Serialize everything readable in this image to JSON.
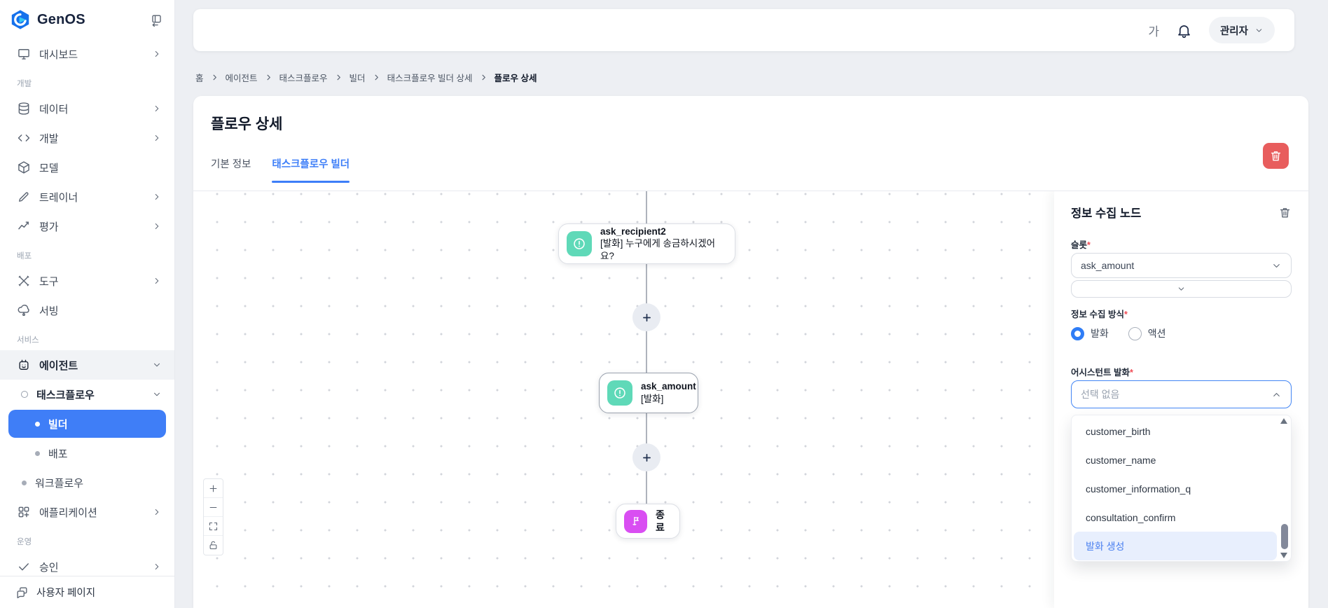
{
  "app": {
    "name": "GenOS"
  },
  "header": {
    "font_toggle": "가",
    "profile": "관리자"
  },
  "sidebar": {
    "logo": "GenOS",
    "sections": {
      "dev": "개발",
      "deploy": "배포",
      "service": "서비스",
      "ops": "운영"
    },
    "items": {
      "dashboard": "대시보드",
      "data": "데이터",
      "develop": "개발",
      "model": "모델",
      "trainer": "트레이너",
      "evaluate": "평가",
      "tools": "도구",
      "serving": "서빙",
      "agent": "에이전트",
      "taskflow": "태스크플로우",
      "builder": "빌더",
      "deploy": "배포",
      "workflow": "워크플로우",
      "application": "애플리케이션",
      "approval": "승인",
      "user_page": "사용자 페이지"
    }
  },
  "breadcrumb": {
    "items": [
      "홈",
      "에이전트",
      "태스크플로우",
      "빌더",
      "태스크플로우 빌더 상세",
      "플로우 상세"
    ]
  },
  "page": {
    "title": "플로우 상세",
    "tabs": {
      "basic": "기본 정보",
      "builder": "태스크플로우 빌더"
    }
  },
  "canvas": {
    "nodes": {
      "recipient": {
        "title": "ask_recipient2",
        "subtitle": "[발화]  누구에게 송금하시겠어요?"
      },
      "amount": {
        "title": "ask_amount",
        "subtitle": "[발화]"
      },
      "end": {
        "label": "종료"
      }
    }
  },
  "panel": {
    "title": "정보 수집 노드",
    "required_mark": "*",
    "slot": {
      "label": "슬롯",
      "value": "ask_amount"
    },
    "method": {
      "label": "정보 수집 방식",
      "selected": "발화",
      "options": {
        "utterance": "발화",
        "action": "액션"
      }
    },
    "assistant": {
      "label": "어시스턴트 발화",
      "value": "선택 없음",
      "options": [
        "customer_birth",
        "customer_name",
        "customer_information_q",
        "consultation_confirm",
        "발화 생성"
      ],
      "highlighted": "발화 생성"
    }
  },
  "colors": {
    "accent": "#3d7ef8",
    "teal": "#5fd9b8",
    "magenta": "#d94ef2",
    "danger": "#e85d5d",
    "active_pill": "#3f7ef7"
  },
  "icons": {
    "logo": "genos-hexagon-mark",
    "collapse": "panel-collapse",
    "bell": "notification-bell",
    "node_utterance": "exclamation-circle",
    "node_end": "flag",
    "delete": "trash",
    "zoom_in": "plus",
    "zoom_out": "minus",
    "fit_view": "expand",
    "lock": "padlock-open"
  }
}
